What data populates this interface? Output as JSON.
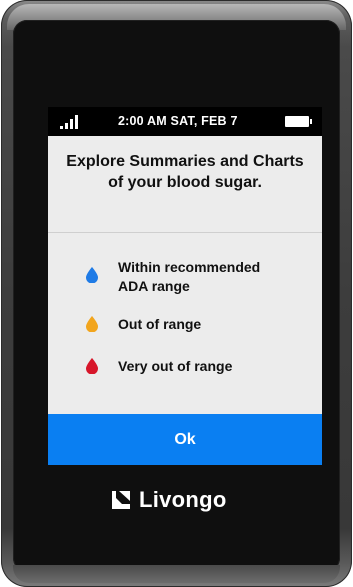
{
  "status_bar": {
    "time": "2:00 AM SAT, FEB 7",
    "signal_icon": "signal-bars-icon",
    "battery_icon": "battery-icon"
  },
  "screen": {
    "headline": "Explore Summaries and Charts of your blood sugar."
  },
  "legend": [
    {
      "label_line1": "Within recommended",
      "label_line2": "ADA range",
      "color": "#1f7be6",
      "icon": "blue-drop-icon"
    },
    {
      "label_line1": "Out of range",
      "label_line2": "",
      "color": "#f2a51d",
      "icon": "orange-drop-icon"
    },
    {
      "label_line1": "Very out of range",
      "label_line2": "",
      "color": "#d7162a",
      "icon": "red-drop-icon"
    }
  ],
  "actions": {
    "ok_label": "Ok"
  },
  "brand": {
    "name": "Livongo"
  },
  "colors": {
    "button": "#0a7ff2",
    "screen_bg": "#ececec",
    "status_bar": "#000000",
    "device_body": "#3d3d3d"
  }
}
